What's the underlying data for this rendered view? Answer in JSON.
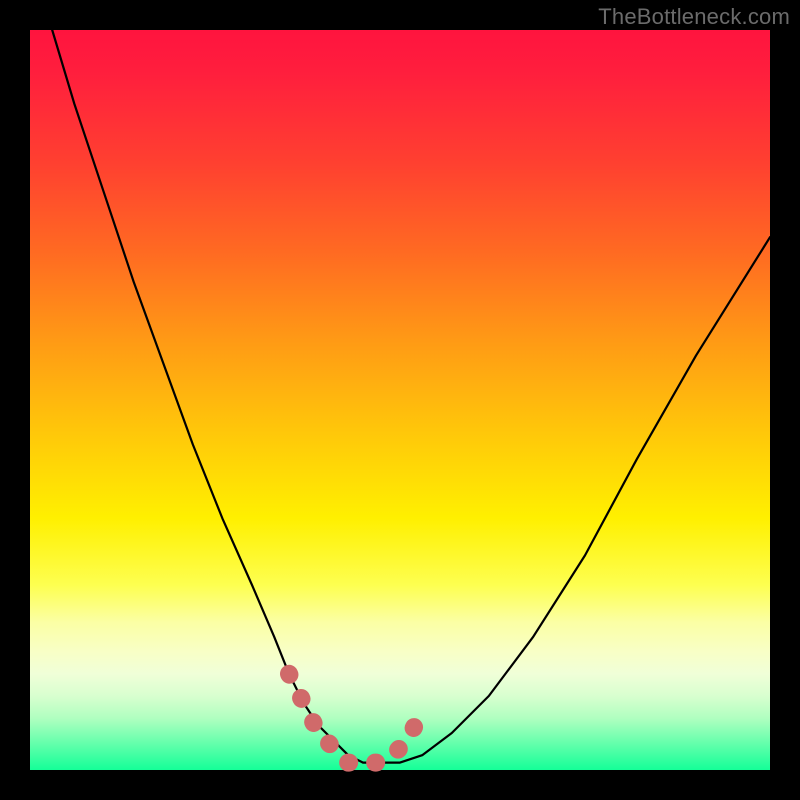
{
  "watermark": "TheBottleneck.com",
  "chart_data": {
    "type": "line",
    "title": "",
    "xlabel": "",
    "ylabel": "",
    "xlim": [
      0,
      100
    ],
    "ylim": [
      0,
      100
    ],
    "grid": false,
    "legend": false,
    "series": [
      {
        "name": "curve",
        "color": "#000000",
        "x": [
          3,
          6,
          10,
          14,
          18,
          22,
          26,
          30,
          33,
          35,
          37,
          39,
          41,
          43,
          45,
          47,
          50,
          53,
          57,
          62,
          68,
          75,
          82,
          90,
          100
        ],
        "values": [
          100,
          90,
          78,
          66,
          55,
          44,
          34,
          25,
          18,
          13,
          9,
          6,
          4,
          2,
          1,
          1,
          1,
          2,
          5,
          10,
          18,
          29,
          42,
          56,
          72
        ]
      },
      {
        "name": "bottom-marker",
        "color": "#d06a6a",
        "style": "thick-dotted",
        "x": [
          35,
          37,
          39,
          41,
          43,
          45,
          47,
          49,
          51,
          53
        ],
        "values": [
          13,
          9,
          5,
          3,
          1,
          1,
          1,
          2,
          4,
          8
        ]
      }
    ],
    "annotations": []
  }
}
